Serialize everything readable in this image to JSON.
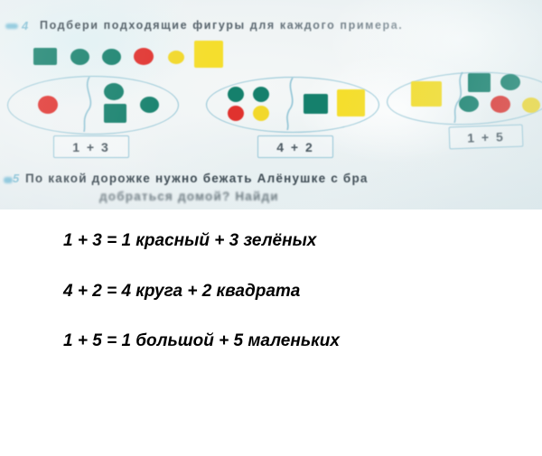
{
  "textbook": {
    "exercise_number": "4",
    "task_text": "Подбери подходящие фигуры для каждого примера.",
    "next_exercise_number": "5",
    "next_task_line1": "По какой дорожке нужно бежать Алёнушке с бра",
    "next_task_line2": "добраться домой? Найди",
    "colors": {
      "green": "#15806c",
      "red": "#e0322e",
      "yellow": "#f2d82b",
      "oval_outline": "#8fc3d4",
      "paper": "#eef3f4",
      "ink": "#3a4750"
    },
    "legend_row": {
      "name": "shape-legend-row",
      "shapes": [
        {
          "shape": "square",
          "color": "green",
          "size": "medium"
        },
        {
          "shape": "circle",
          "color": "green",
          "size": "medium"
        },
        {
          "shape": "circle",
          "color": "green",
          "size": "medium"
        },
        {
          "shape": "circle",
          "color": "red",
          "size": "medium"
        },
        {
          "shape": "circle",
          "color": "yellow",
          "size": "small"
        },
        {
          "shape": "square",
          "color": "yellow",
          "size": "large"
        }
      ]
    },
    "groups": [
      {
        "id": "group-1",
        "label": "1 + 3",
        "left_part": [
          {
            "shape": "circle",
            "color": "red"
          }
        ],
        "right_part": [
          {
            "shape": "circle",
            "color": "green"
          },
          {
            "shape": "square",
            "color": "green"
          },
          {
            "shape": "circle",
            "color": "green"
          }
        ]
      },
      {
        "id": "group-2",
        "label": "4 + 2",
        "left_part": [
          {
            "shape": "circle",
            "color": "green"
          },
          {
            "shape": "circle",
            "color": "green"
          },
          {
            "shape": "circle",
            "color": "red"
          },
          {
            "shape": "circle",
            "color": "yellow"
          }
        ],
        "right_part": [
          {
            "shape": "square",
            "color": "green"
          },
          {
            "shape": "square",
            "color": "yellow"
          }
        ]
      },
      {
        "id": "group-3",
        "label": "1 + 5",
        "left_part": [
          {
            "shape": "square",
            "color": "yellow",
            "size": "large"
          }
        ],
        "right_part": [
          {
            "shape": "square",
            "color": "green"
          },
          {
            "shape": "circle",
            "color": "green"
          },
          {
            "shape": "circle",
            "color": "green"
          },
          {
            "shape": "circle",
            "color": "red"
          },
          {
            "shape": "circle",
            "color": "yellow"
          }
        ]
      }
    ]
  },
  "answer_panel": {
    "lines": [
      "1 + 3 = 1 красный + 3 зелёных",
      "4 + 2 = 4 круга + 2 квадрата",
      "1 + 5 = 1 большой + 5 маленьких"
    ]
  }
}
